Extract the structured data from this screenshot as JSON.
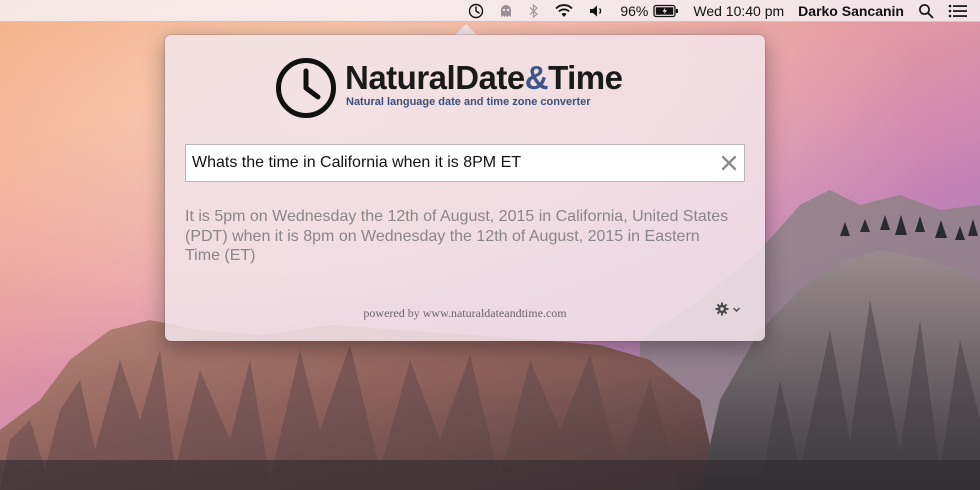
{
  "menubar": {
    "icons": [
      "clock-icon",
      "app-icon",
      "bluetooth-icon",
      "wifi-icon",
      "volume-icon",
      "battery-icon",
      "search-icon",
      "menu-list-icon"
    ],
    "battery_percent": "96%",
    "datetime": "Wed 10:40 pm",
    "user_name": "Darko Sancanin"
  },
  "app": {
    "title_part1": "NaturalDate",
    "title_amp": "&",
    "title_part2": "Time",
    "subtitle": "Natural language date and time zone converter",
    "accent_color": "#3f5586"
  },
  "query": {
    "value": "Whats the time in California when it is 8PM ET",
    "clear_icon": "close-icon"
  },
  "result": {
    "text": "It is 5pm on Wednesday the 12th of August, 2015 in California, United States (PDT) when it is 8pm on Wednesday the 12th of August, 2015 in Eastern Time (ET)"
  },
  "footer": {
    "powered_by": "powered by www.naturaldateandtime.com",
    "settings_icon": "gear-icon"
  }
}
